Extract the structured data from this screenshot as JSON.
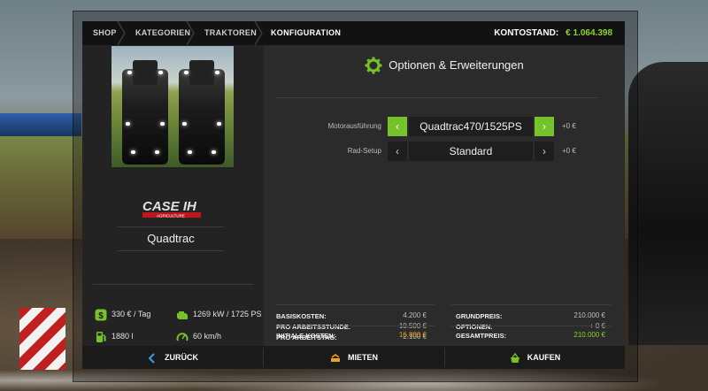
{
  "breadcrumb": [
    "SHOP",
    "KATEGORIEN",
    "TRAKTOREN",
    "KONFIGURATION"
  ],
  "account": {
    "label": "KONTOSTAND:",
    "value": "€ 1.064.398"
  },
  "vehicle": {
    "brand_logo": "CASE IH",
    "brand_sub": "AGRICULTURE",
    "name": "Quadtrac",
    "stats": [
      {
        "icon": "dollar-icon",
        "text": "330 € / Tag"
      },
      {
        "icon": "engine-icon",
        "text": "1269 kW / 1725 PS"
      },
      {
        "icon": "fuel-icon",
        "text": "1880 l"
      },
      {
        "icon": "speedometer-icon",
        "text": "60 km/h"
      }
    ]
  },
  "options": {
    "title": "Optionen & Erweiterungen",
    "rows": [
      {
        "label": "Motorausführung",
        "value": "Quadtrac470/1525PS",
        "price": "+0 €",
        "active": true
      },
      {
        "label": "Rad-Setup",
        "value": "Standard",
        "price": "+0 €",
        "active": false
      }
    ]
  },
  "costs": {
    "basiskosten_label": "BASISKOSTEN:",
    "basiskosten": "4.200 €",
    "arbeitsstunde_label": "PRO ARBEITSSTUNDE:",
    "arbeitsstunde": "10.500 €",
    "arbeitstag_label": "PRO ARBEITSTAG:",
    "arbeitstag": "2.100 €",
    "initial_label": "INITIALE KOSTEN:",
    "initial": "16.800 €",
    "grundpreis_label": "GRUNDPREIS:",
    "grundpreis": "210.000 €",
    "optionen_label": "OPTIONEN:",
    "optionen": "+ 0 €",
    "gesamt_label": "GESAMTPREIS:",
    "gesamt": "210.000 €"
  },
  "buttons": {
    "back": "ZURÜCK",
    "rent": "MIETEN",
    "buy": "KAUFEN"
  },
  "colors": {
    "accent": "#76c22a",
    "price_green": "#8bd42c",
    "price_orange": "#f0a020"
  }
}
